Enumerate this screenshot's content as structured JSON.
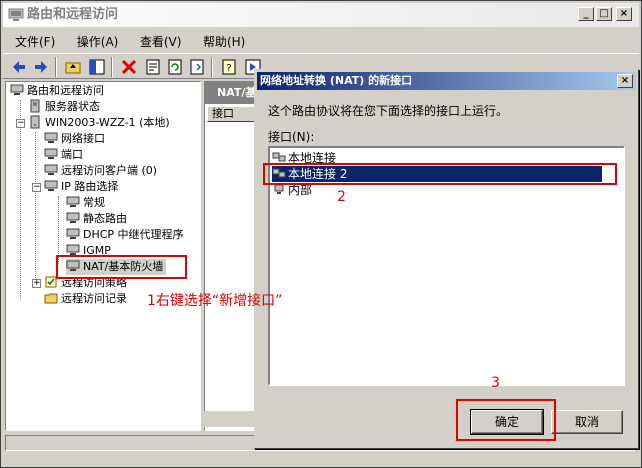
{
  "window": {
    "title": "路由和远程访问",
    "min_label": "_",
    "max_label": "□",
    "close_label": "×"
  },
  "menu": [
    {
      "label": "文件(F)"
    },
    {
      "label": "操作(A)"
    },
    {
      "label": "查看(V)"
    },
    {
      "label": "帮助(H)"
    }
  ],
  "tree": {
    "root": "路由和远程访问",
    "server_status": "服务器状态",
    "server": "WIN2003-WZZ-1 (本地)",
    "network_interfaces": "网络接口",
    "ports": "端口",
    "remote_clients": "远程访问客户端 (0)",
    "ip_routing": "IP 路由选择",
    "general": "常规",
    "static_routes": "静态路由",
    "dhcp_relay": "DHCP 中继代理程序",
    "igmp": "IGMP",
    "nat": "NAT/基本防火墙",
    "remote_policies": "远程访问策略",
    "remote_logging": "远程访问记录"
  },
  "right_pane": {
    "header": "NAT/基",
    "col_interface": "接口"
  },
  "dialog": {
    "title": "网络地址转换 (NAT) 的新接口",
    "close_label": "×",
    "description": "这个路由协议将在您下面选择的接口上运行。",
    "list_label": "接口(N):",
    "interfaces": [
      {
        "label": "本地连接",
        "selected": false
      },
      {
        "label": "本地连接 2",
        "selected": true
      },
      {
        "label": "内部",
        "selected": false
      }
    ],
    "ok_label": "确定",
    "cancel_label": "取消"
  },
  "annotations": {
    "step1": "1右键选择“新增接口”",
    "step2": "2",
    "step3": "3",
    "color": "#e00000"
  },
  "colors": {
    "dialog_title_start": "#0a246a",
    "dialog_title_end": "#a6caf0",
    "selection": "#0a246a",
    "face": "#d4d0c8"
  }
}
